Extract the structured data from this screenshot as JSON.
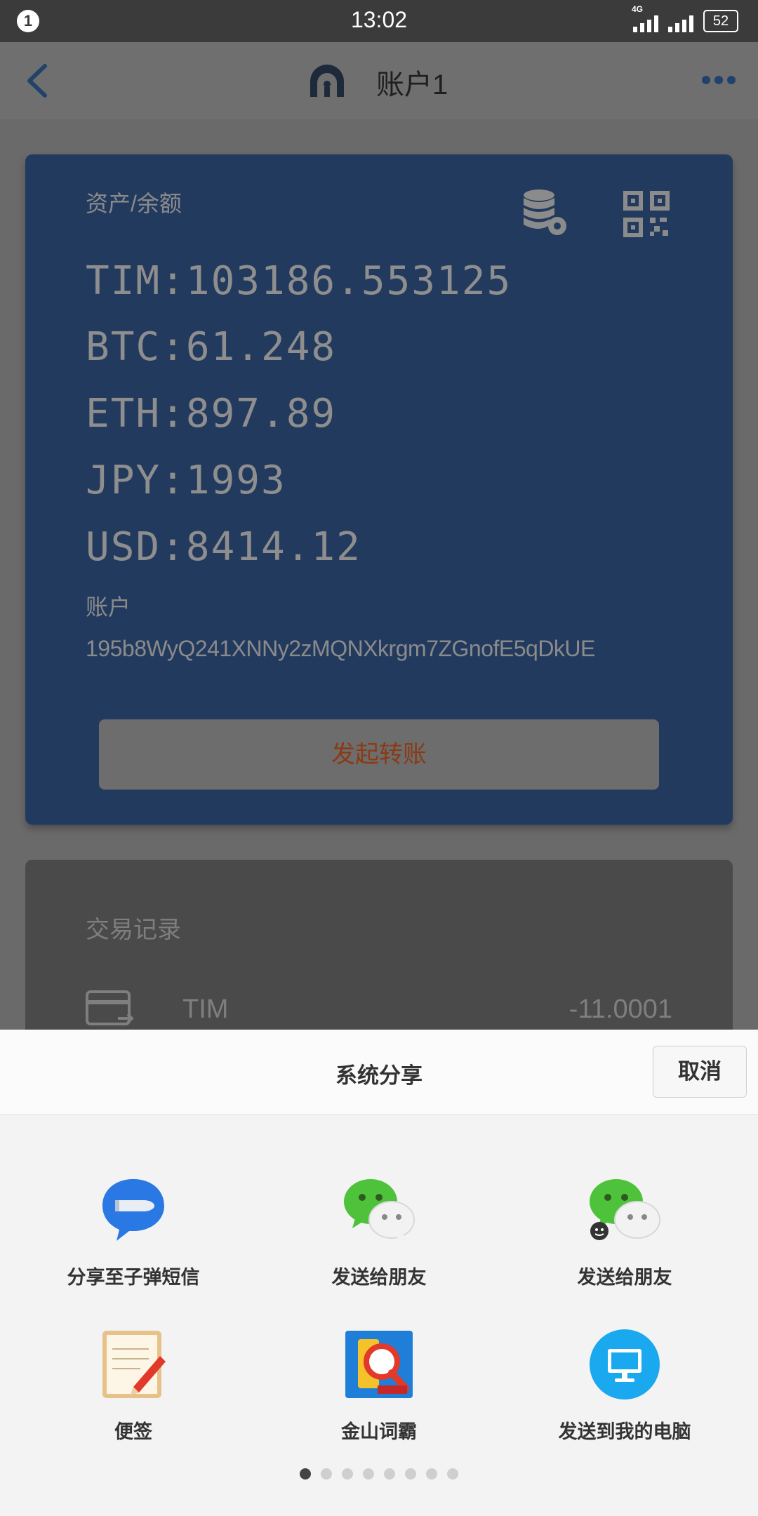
{
  "status_bar": {
    "notification_count": "1",
    "time": "13:02",
    "network": "4G",
    "battery": "52"
  },
  "app_bar": {
    "title": "账户1"
  },
  "account_card": {
    "balance_label": "资产/余额",
    "assets": [
      "TIM:103186.553125",
      "BTC:61.248",
      "ETH:897.89",
      "JPY:1993",
      "USD:8414.12"
    ],
    "account_label": "账户",
    "account_id": "195b8WyQ241XNNy2zMQNXkrgm7ZGnofE5qDkUE",
    "transfer_button": "发起转账"
  },
  "transactions": {
    "title": "交易记录",
    "items": [
      {
        "name": "TIM",
        "amount": "-11.0001"
      }
    ]
  },
  "share_sheet": {
    "title": "系统分享",
    "cancel": "取消",
    "items": [
      {
        "label": "分享至子弹短信",
        "icon": "bullet-messenger-icon"
      },
      {
        "label": "发送给朋友",
        "icon": "wechat-icon"
      },
      {
        "label": "发送给朋友",
        "icon": "wechat-work-icon"
      },
      {
        "label": "便签",
        "icon": "notepad-icon"
      },
      {
        "label": "金山词霸",
        "icon": "kingsoft-dictionary-icon"
      },
      {
        "label": "发送到我的电脑",
        "icon": "computer-icon"
      }
    ],
    "page_indicator": {
      "total": 8,
      "active": 0
    }
  },
  "colors": {
    "card_blue": "#233a5f",
    "accent_blue": "#22426b",
    "wechat_green": "#4ec23a",
    "computer_blue": "#1aa8ee"
  }
}
